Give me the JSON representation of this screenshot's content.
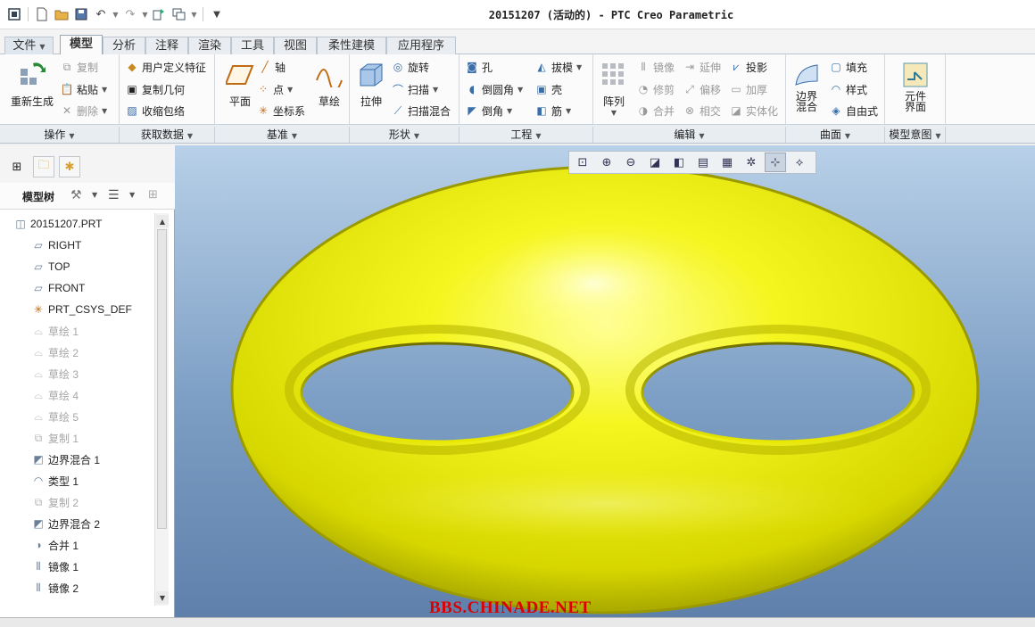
{
  "window": {
    "title": "20151207 (活动的) - PTC Creo Parametric"
  },
  "quick_access": {
    "icons": [
      "window-icon",
      "new-icon",
      "open-icon",
      "save-icon",
      "undo-icon",
      "redo-icon",
      "regenerate-icon",
      "windows-icon",
      "customize-icon"
    ]
  },
  "tabs": [
    {
      "label": "文件",
      "has_dropdown": true
    },
    {
      "label": "模型",
      "active": true
    },
    {
      "label": "分析"
    },
    {
      "label": "注释"
    },
    {
      "label": "渲染"
    },
    {
      "label": "工具"
    },
    {
      "label": "视图"
    },
    {
      "label": "柔性建模"
    },
    {
      "label": "应用程序"
    }
  ],
  "ribbon": {
    "operations": {
      "regenerate": "重新生成",
      "copy": "复制",
      "paste": "粘贴",
      "delete": "删除"
    },
    "get_data": {
      "user_defined_feature": "用户定义特征",
      "copy_geometry": "复制几何",
      "shrinkwrap": "收缩包络"
    },
    "datum": {
      "plane": "平面",
      "axis": "轴",
      "point": "点",
      "csys": "坐标系",
      "sketch": "草绘"
    },
    "shapes": {
      "extrude": "拉伸",
      "revolve": "旋转",
      "sweep": "扫描",
      "swept_blend": "扫描混合"
    },
    "engineering": {
      "hole": "孔",
      "round": "倒圆角",
      "chamfer": "倒角",
      "draft": "拔模",
      "shell": "壳",
      "rib": "筋"
    },
    "editing": {
      "pattern": "阵列",
      "mirror": "镜像",
      "trim": "修剪",
      "merge": "合并",
      "extend": "延伸",
      "offset": "偏移",
      "intersect": "相交",
      "project": "投影",
      "thicken": "加厚",
      "solidify": "实体化"
    },
    "surfaces": {
      "boundary_blend_l1": "边界",
      "boundary_blend_l2": "混合",
      "fill": "填充",
      "style": "样式",
      "freestyle": "自由式"
    },
    "model_intent": {
      "component_interface_l1": "元件",
      "component_interface_l2": "界面"
    }
  },
  "group_labels": [
    "操作",
    "获取数据",
    "基准",
    "形状",
    "工程",
    "编辑",
    "曲面",
    "模型意图"
  ],
  "model_tree": {
    "title": "模型树",
    "nodes": [
      {
        "label": "20151207.PRT",
        "icon": "part-icon",
        "dim": false
      },
      {
        "label": "RIGHT",
        "icon": "datum-plane-icon",
        "dim": false
      },
      {
        "label": "TOP",
        "icon": "datum-plane-icon",
        "dim": false
      },
      {
        "label": "FRONT",
        "icon": "datum-plane-icon",
        "dim": false
      },
      {
        "label": "PRT_CSYS_DEF",
        "icon": "csys-icon",
        "dim": false
      },
      {
        "label": "草绘 1",
        "icon": "sketch-icon",
        "dim": true
      },
      {
        "label": "草绘 2",
        "icon": "sketch-icon",
        "dim": true
      },
      {
        "label": "草绘 3",
        "icon": "sketch-icon",
        "dim": true
      },
      {
        "label": "草绘 4",
        "icon": "sketch-icon",
        "dim": true
      },
      {
        "label": "草绘 5",
        "icon": "sketch-icon",
        "dim": true
      },
      {
        "label": "复制 1",
        "icon": "copy-icon",
        "dim": true
      },
      {
        "label": "边界混合 1",
        "icon": "boundary-blend-icon",
        "dim": false
      },
      {
        "label": "类型 1",
        "icon": "style-icon",
        "dim": false
      },
      {
        "label": "复制 2",
        "icon": "copy-icon",
        "dim": true
      },
      {
        "label": "边界混合 2",
        "icon": "boundary-blend-icon",
        "dim": false
      },
      {
        "label": "合并 1",
        "icon": "merge-icon",
        "dim": false
      },
      {
        "label": "镜像 1",
        "icon": "mirror-icon",
        "dim": false
      },
      {
        "label": "镜像 2",
        "icon": "mirror-icon",
        "dim": false
      }
    ]
  },
  "view_toolbar": {
    "icons": [
      "refit-icon",
      "zoom-in-icon",
      "zoom-out-icon",
      "repaint-icon",
      "display-style-icon",
      "saved-views-icon",
      "view-manager-icon",
      "datum-display-icon",
      "spin-center-icon",
      "annotation-display-icon"
    ]
  },
  "colors": {
    "model": "#f2f21a",
    "accent": "#9aa9b8",
    "watermark": "#dd0000"
  },
  "watermark": "BBS.CHINADE.NET"
}
